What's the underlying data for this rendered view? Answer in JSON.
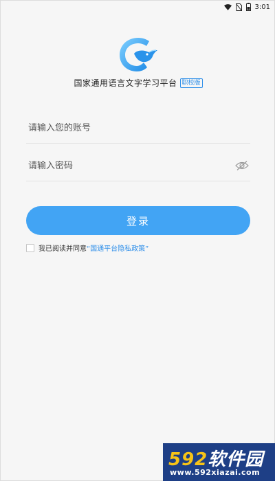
{
  "status_bar": {
    "time": "3:01",
    "icons": [
      "wifi-icon",
      "no-sim-icon",
      "battery-icon"
    ]
  },
  "app": {
    "title": "国家通用语言文字学习平台",
    "edition": "职校版",
    "logo_icon": "bird-logo-icon",
    "brand_color": "#42a4f4"
  },
  "form": {
    "account_placeholder": "请输入您的账号",
    "account_value": "",
    "password_placeholder": "请输入密码",
    "password_value": "",
    "password_toggle_icon": "eye-hidden-icon",
    "login_label": "登录"
  },
  "agreement": {
    "checked": false,
    "prefix": "我已阅读并同意",
    "link": "“国通平台隐私政策”"
  },
  "watermark": {
    "num": "592",
    "text": "软件园",
    "url": "www.592xiazai.com"
  }
}
